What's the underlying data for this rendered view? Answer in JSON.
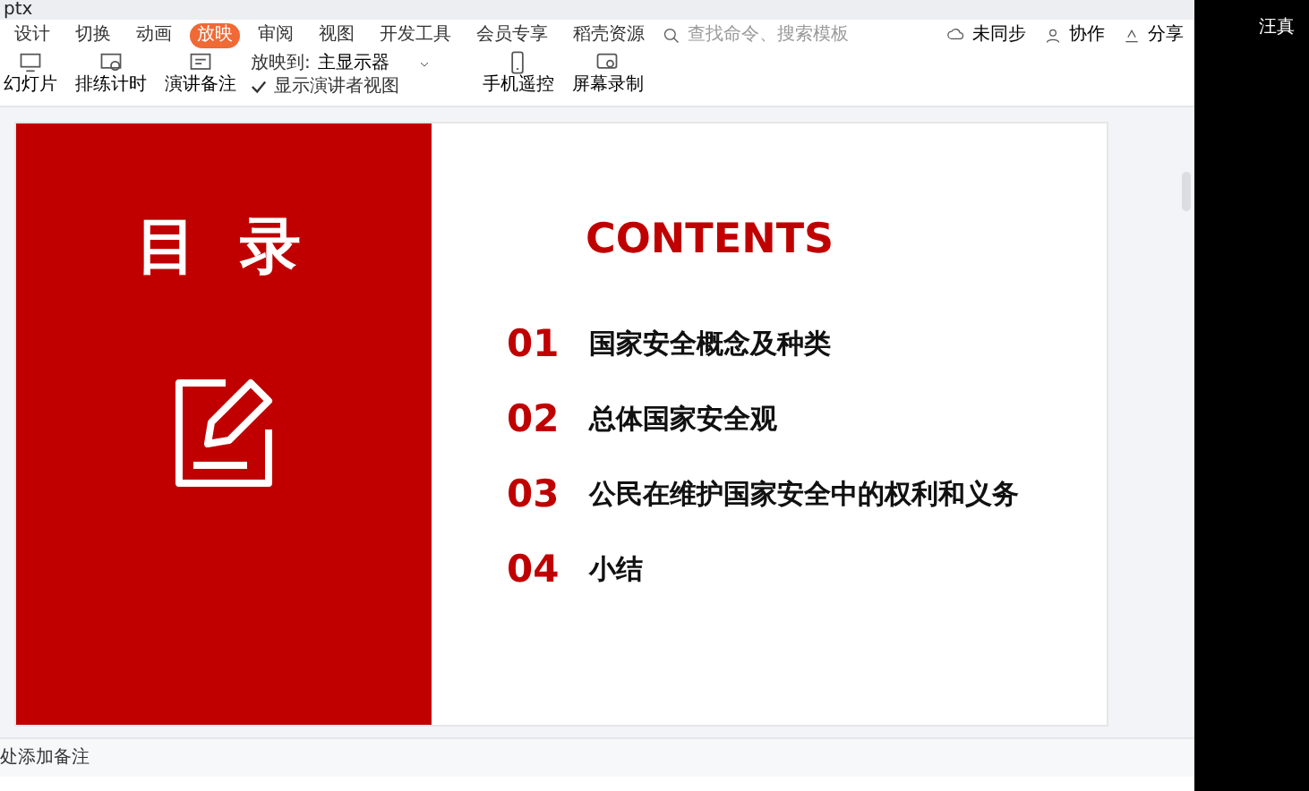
{
  "title_tab": {
    "label": "ptx"
  },
  "menu_tabs": [
    {
      "label": "设计",
      "selected": false
    },
    {
      "label": "切换",
      "selected": false
    },
    {
      "label": "动画",
      "selected": false
    },
    {
      "label": "放映",
      "selected": true
    },
    {
      "label": "审阅",
      "selected": false
    },
    {
      "label": "视图",
      "selected": false
    },
    {
      "label": "开发工具",
      "selected": false
    },
    {
      "label": "会员专享",
      "selected": false
    },
    {
      "label": "稻壳资源",
      "selected": false
    }
  ],
  "search": {
    "placeholder": "查找命令、搜索模板"
  },
  "top_actions": [
    "未同步",
    "协作",
    "分享"
  ],
  "ribbon": {
    "tools": [
      "幻灯片",
      "排练计时",
      "演讲备注"
    ],
    "display_label": "放映到:",
    "display_value": "主显示器",
    "presenter_view": {
      "label": "显示演讲者视图",
      "checked": true
    },
    "tools2": [
      "手机遥控",
      "屏幕录制"
    ]
  },
  "slide": {
    "heading": "目 录",
    "contents_title": "CONTENTS",
    "items": [
      {
        "number": "01",
        "text": "国家安全概念及种类"
      },
      {
        "number": "02",
        "text": "总体国家安全观"
      },
      {
        "number": "03",
        "text": "公民在维护国家安全中的权利和义务"
      },
      {
        "number": "04",
        "text": "小结"
      }
    ]
  },
  "notes": {
    "placeholder": "处添加备注"
  },
  "side_panel": {
    "name": "汪真"
  }
}
